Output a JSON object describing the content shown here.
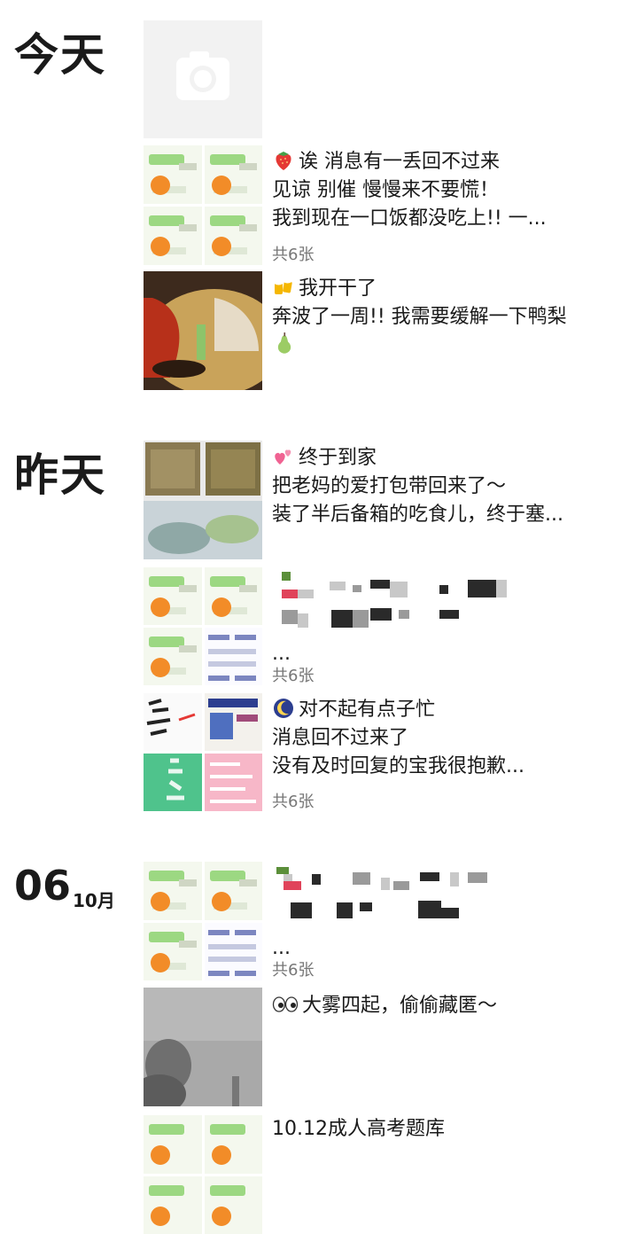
{
  "sections": {
    "today": {
      "label": "今天"
    },
    "yesterday": {
      "label": "昨天"
    },
    "oct6": {
      "day": "06",
      "month": "10月"
    }
  },
  "posts": [
    {
      "id": "camera",
      "type": "camera-placeholder",
      "icon": "camera-icon"
    },
    {
      "id": "p1",
      "emoji": "strawberry",
      "lines": [
        "诶 消息有一丢回不过来",
        "见谅 别催 慢慢来不要慌！",
        "我到现在一口饭都没吃上!! 一..."
      ],
      "count": "共6张"
    },
    {
      "id": "p2",
      "emoji": "beer-mugs",
      "lines": [
        "我开干了",
        "奔波了一周!! 我需要缓解一下鸭梨"
      ],
      "trailing_emoji": "pear"
    },
    {
      "id": "p3",
      "emoji": "two-hearts",
      "lines": [
        "终于到家",
        "把老妈的爱打包带回来了～",
        "装了半后备箱的吃食儿，终于塞..."
      ]
    },
    {
      "id": "p4",
      "lines": [
        "..."
      ],
      "count": "共6张",
      "pixelated": true
    },
    {
      "id": "p5",
      "emoji": "crescent-moon",
      "lines": [
        "对不起有点子忙",
        "消息回不过来了",
        "没有及时回复的宝我很抱歉..."
      ],
      "count": "共6张"
    },
    {
      "id": "p6",
      "lines": [
        "..."
      ],
      "count": "共6张",
      "pixelated": true
    },
    {
      "id": "p7",
      "emoji": "eyes",
      "lines": [
        "大雾四起，偷偷藏匿～"
      ]
    },
    {
      "id": "p8",
      "lines": [
        "10.12成人高考题库"
      ]
    }
  ],
  "colors": {
    "text": "#1a1a1a",
    "count_text": "#777777",
    "accent_green": "#9cd882",
    "accent_orange": "#f28c28"
  }
}
